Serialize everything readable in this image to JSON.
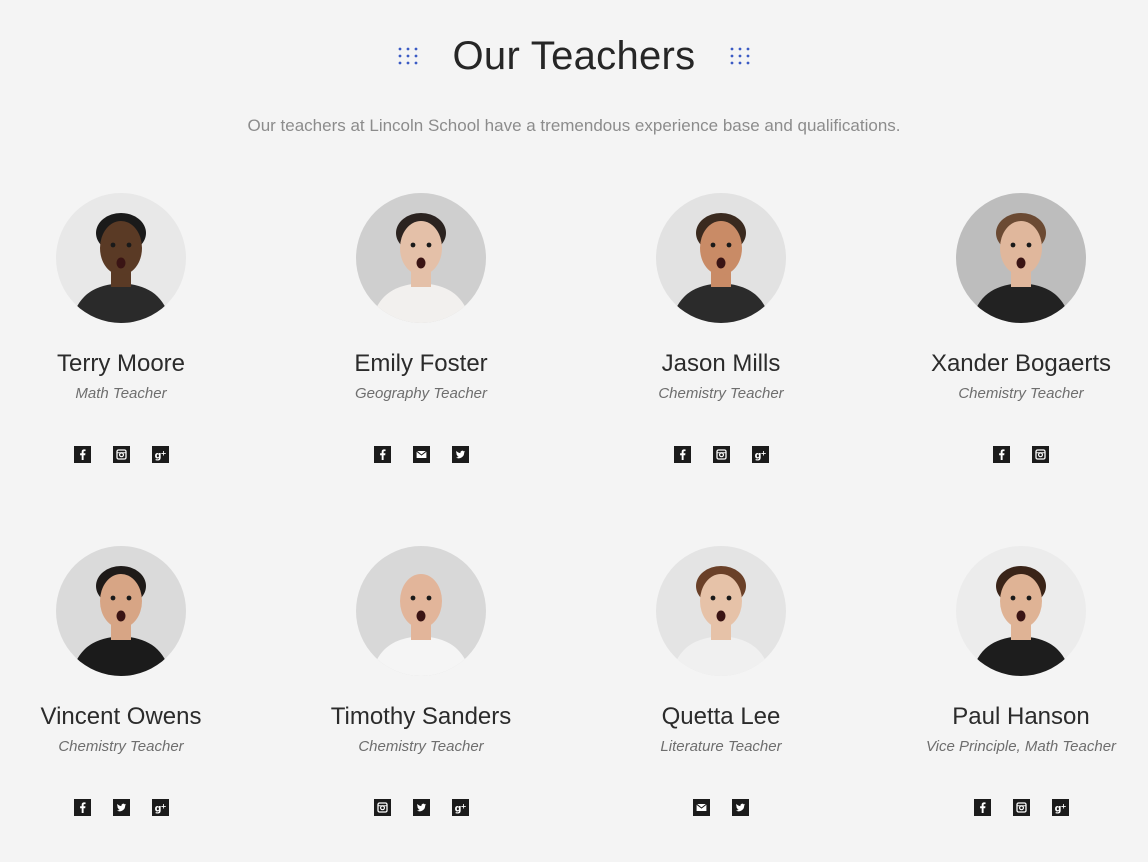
{
  "header": {
    "title": "Our Teachers",
    "subtitle": "Our teachers at Lincoln School have a tremendous experience base and qualifications.",
    "accent_color": "#3b5bc4"
  },
  "teachers": [
    {
      "name": "Terry Moore",
      "role": "Math Teacher",
      "socials": [
        "facebook",
        "instagram",
        "google-plus"
      ],
      "skin": "#5a3a25",
      "hair": "#1a1a1a",
      "shirt": "#2a2a2a",
      "bg": "#e8e8e8"
    },
    {
      "name": "Emily Foster",
      "role": "Geography Teacher",
      "socials": [
        "facebook",
        "email",
        "twitter"
      ],
      "skin": "#e4c0a8",
      "hair": "#2b2320",
      "shirt": "#f2f0ee",
      "bg": "#cfcfcf"
    },
    {
      "name": "Jason Mills",
      "role": "Chemistry Teacher",
      "socials": [
        "facebook",
        "instagram",
        "google-plus"
      ],
      "skin": "#c98b66",
      "hair": "#3a2a1f",
      "shirt": "#2b2b2b",
      "bg": "#e2e2e2"
    },
    {
      "name": "Xander Bogaerts",
      "role": "Chemistry Teacher",
      "socials": [
        "facebook",
        "instagram"
      ],
      "skin": "#e0b79c",
      "hair": "#6b4a33",
      "shirt": "#222222",
      "bg": "#bdbdbd"
    },
    {
      "name": "Vincent Owens",
      "role": "Chemistry Teacher",
      "socials": [
        "facebook",
        "twitter",
        "google-plus"
      ],
      "skin": "#d7a585",
      "hair": "#1e1a18",
      "shirt": "#1b1b1b",
      "bg": "#dadada"
    },
    {
      "name": "Timothy Sanders",
      "role": "Chemistry Teacher",
      "socials": [
        "instagram",
        "twitter",
        "google-plus"
      ],
      "skin": "#e2b59a",
      "hair": "#e2b59a",
      "shirt": "#f5f5f5",
      "bg": "#d8d8d8"
    },
    {
      "name": "Quetta Lee",
      "role": "Literature Teacher",
      "socials": [
        "email",
        "twitter"
      ],
      "skin": "#e6c2a8",
      "hair": "#6a4028",
      "shirt": "#f0f0f0",
      "bg": "#e4e4e4"
    },
    {
      "name": "Paul Hanson",
      "role": "Vice Principle, Math Teacher",
      "socials": [
        "facebook",
        "instagram",
        "google-plus"
      ],
      "skin": "#dfb395",
      "hair": "#3a2418",
      "shirt": "#1d1d1d",
      "bg": "#ececec"
    }
  ]
}
